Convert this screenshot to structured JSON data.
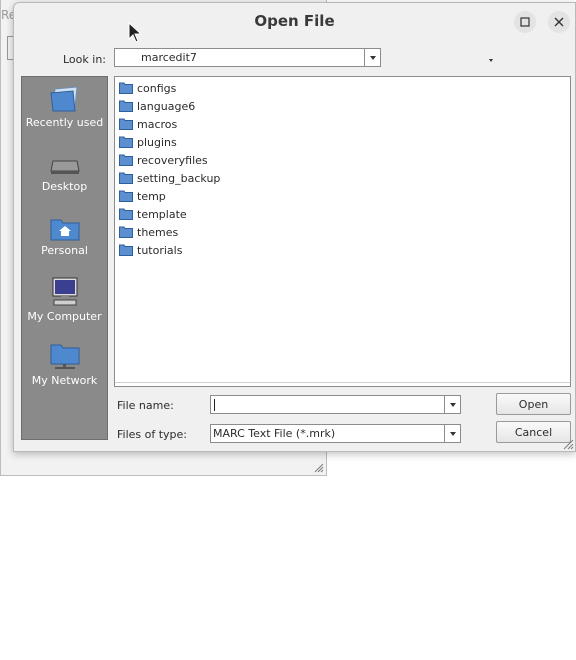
{
  "background_window": {
    "title_fragment": "Re"
  },
  "dialog": {
    "title": "Open File",
    "look_in": {
      "label": "Look in:",
      "value": "marcedit7"
    },
    "places": [
      {
        "label": "Recently used",
        "icon": "recently-used-icon"
      },
      {
        "label": "Desktop",
        "icon": "desktop-icon"
      },
      {
        "label": "Personal",
        "icon": "home-folder-icon"
      },
      {
        "label": "My Computer",
        "icon": "computer-icon"
      },
      {
        "label": "My Network",
        "icon": "network-icon"
      }
    ],
    "files": [
      {
        "name": "configs",
        "type": "folder"
      },
      {
        "name": "language6",
        "type": "folder"
      },
      {
        "name": "macros",
        "type": "folder"
      },
      {
        "name": "plugins",
        "type": "folder"
      },
      {
        "name": "recoveryfiles",
        "type": "folder"
      },
      {
        "name": "setting_backup",
        "type": "folder"
      },
      {
        "name": "temp",
        "type": "folder"
      },
      {
        "name": "template",
        "type": "folder"
      },
      {
        "name": "themes",
        "type": "folder"
      },
      {
        "name": "tutorials",
        "type": "folder"
      }
    ],
    "file_name": {
      "label": "File name:",
      "value": ""
    },
    "file_type": {
      "label": "Files of type:",
      "value": "MARC Text File (*.mrk)"
    },
    "buttons": {
      "open": "Open",
      "cancel": "Cancel"
    }
  },
  "colors": {
    "places_bg": "#8a8a8a",
    "folder": "#5b8fd0",
    "dialog_bg": "#f0f0f0"
  }
}
